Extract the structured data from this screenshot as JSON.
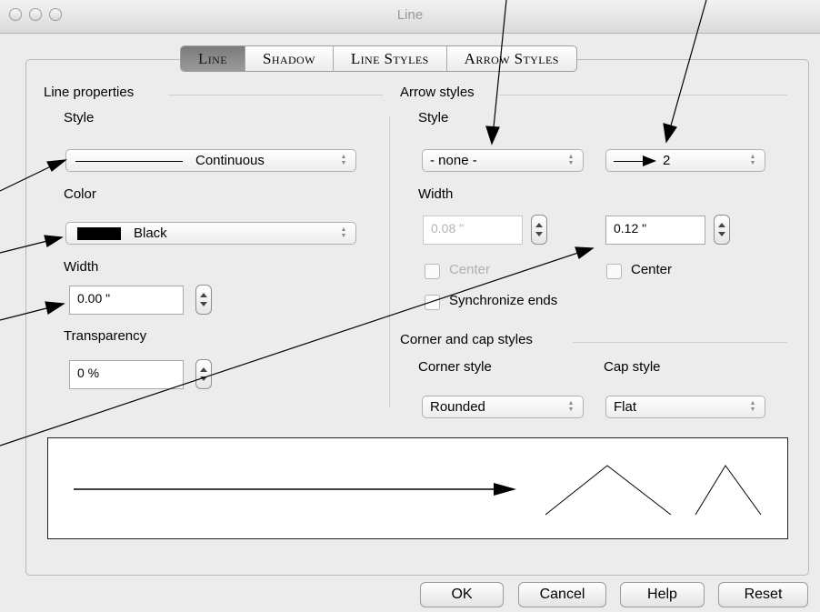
{
  "window": {
    "title": "Line"
  },
  "tabs": [
    "Line",
    "Shadow",
    "Line Styles",
    "Arrow Styles"
  ],
  "active_tab": "Line",
  "line_properties": {
    "heading": "Line properties",
    "style_label": "Style",
    "style_value": "Continuous",
    "color_label": "Color",
    "color_value": "Black",
    "color_swatch": "#000000",
    "width_label": "Width",
    "width_value": "0.00 \"",
    "transparency_label": "Transparency",
    "transparency_value": "0 %"
  },
  "arrow_styles": {
    "heading": "Arrow styles",
    "style_label": "Style",
    "start_style": "- none -",
    "end_style": "2",
    "width_label": "Width",
    "start_width": "0.08 \"",
    "end_width": "0.12 \"",
    "center_label": "Center",
    "synchronize_label": "Synchronize ends"
  },
  "corner_cap": {
    "heading": "Corner and cap styles",
    "corner_label": "Corner style",
    "corner_value": "Rounded",
    "cap_label": "Cap style",
    "cap_value": "Flat"
  },
  "buttons": {
    "ok": "OK",
    "cancel": "Cancel",
    "help": "Help",
    "reset": "Reset"
  }
}
